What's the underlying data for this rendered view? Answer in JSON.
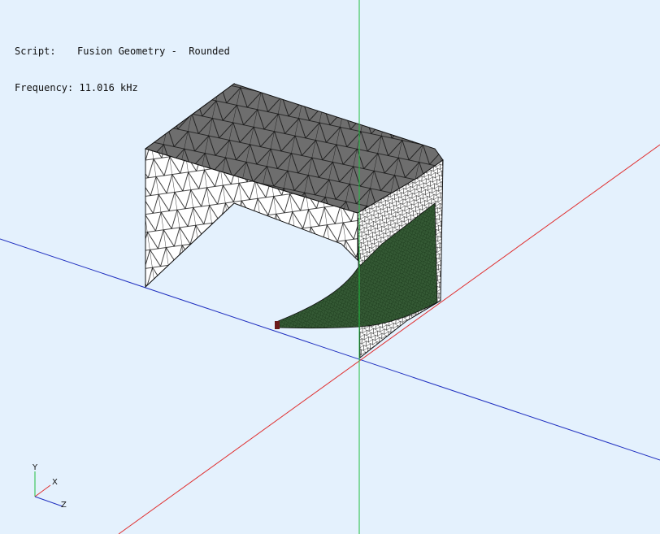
{
  "info": {
    "script_label": "Script:",
    "script_value": "Fusion Geometry -  Rounded",
    "frequency_label": "Frequency:",
    "frequency_value": "11.016 kHz"
  },
  "triad": {
    "x_label": "X",
    "y_label": "Y",
    "z_label": "Z"
  },
  "colors": {
    "background": "#e4f1fd",
    "axis_x": "#e03030",
    "axis_y": "#20c040",
    "axis_z": "#2030c0",
    "mesh_top": "#6e6e6e",
    "mesh_wall": "#ffffff",
    "mesh_lines": "#111111",
    "fine_mesh": "#355a35"
  }
}
